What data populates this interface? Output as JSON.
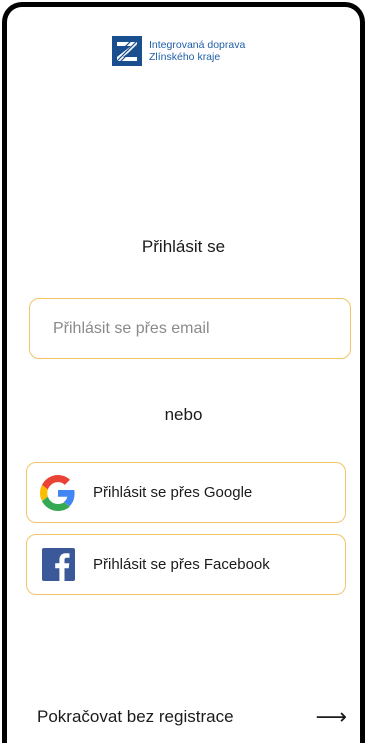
{
  "brand": {
    "line1": "Integrovaná doprava",
    "line2": "Zlínského kraje",
    "color": "#1f5fa8"
  },
  "login": {
    "title": "Přihlásit se",
    "email_placeholder": "Přihlásit se přes email",
    "divider": "nebo",
    "google_label": "Přihlásit se přes Google",
    "facebook_label": "Přihlásit se přes Facebook"
  },
  "footer": {
    "continue_label": "Pokračovat bez registrace",
    "continue_icon": "arrow-right-icon"
  },
  "colors": {
    "field_border": "#f2c46a",
    "facebook": "#3b5998"
  }
}
